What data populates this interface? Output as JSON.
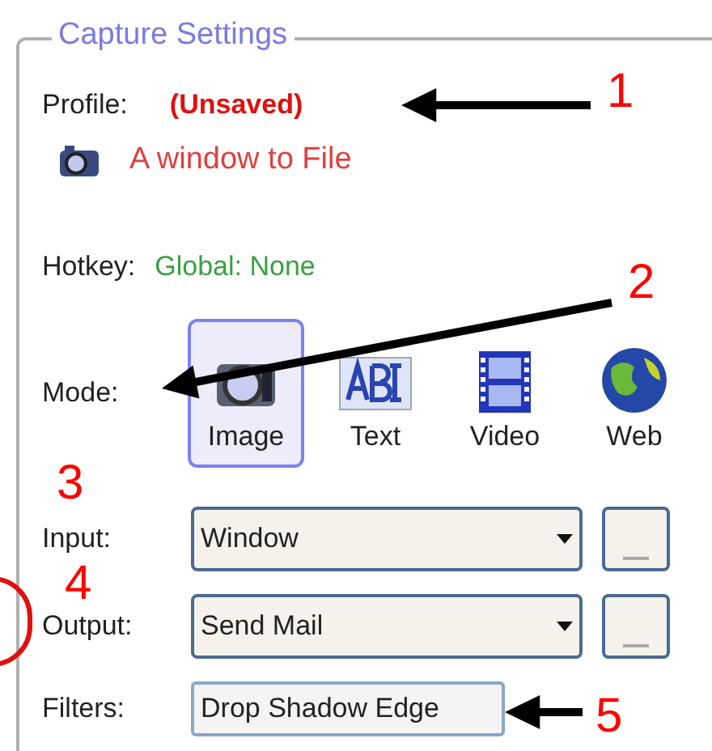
{
  "group": {
    "title": "Capture Settings"
  },
  "profile": {
    "label": "Profile:",
    "value": "(Unsaved)",
    "name": "A window to File"
  },
  "hotkey": {
    "label": "Hotkey:",
    "value": "Global: None"
  },
  "mode": {
    "label": "Mode:",
    "options": [
      {
        "label": "Image",
        "kind": "camera",
        "selected": true
      },
      {
        "label": "Text",
        "kind": "text",
        "selected": false
      },
      {
        "label": "Video",
        "kind": "film",
        "selected": false
      },
      {
        "label": "Web",
        "kind": "globe",
        "selected": false
      }
    ]
  },
  "fields": [
    {
      "label": "Input:",
      "value": "Window",
      "kind": "dropdown"
    },
    {
      "label": "Output:",
      "value": "Send Mail",
      "kind": "dropdown"
    },
    {
      "label": "Filters:",
      "value": "Drop Shadow Edge",
      "kind": "text"
    }
  ],
  "annotations": [
    "1",
    "2",
    "3",
    "4",
    "5"
  ]
}
